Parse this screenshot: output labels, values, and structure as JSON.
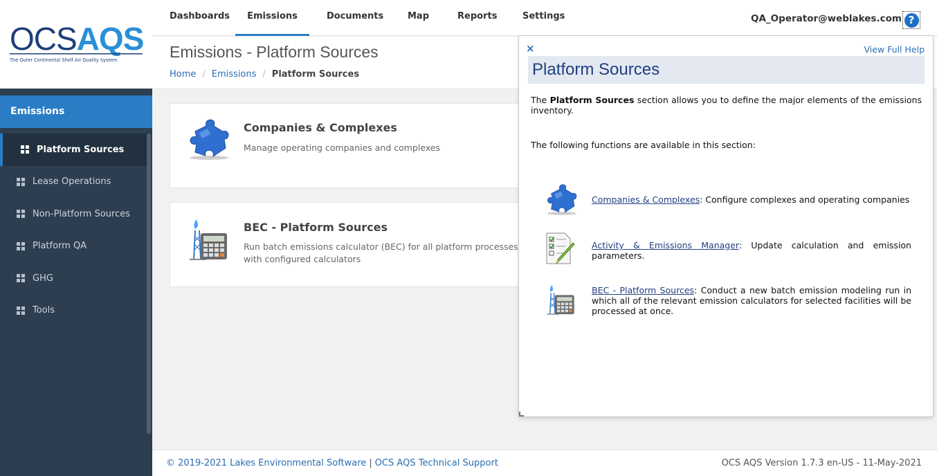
{
  "logo": {
    "primary": "OCS",
    "accent": "AQS",
    "tagline": "The Outer Continental Shelf Air Quality System"
  },
  "sidebar": {
    "section": "Emissions",
    "items": [
      {
        "label": "Platform Sources",
        "active": true
      },
      {
        "label": "Lease Operations",
        "active": false
      },
      {
        "label": "Non-Platform Sources",
        "active": false
      },
      {
        "label": "Platform QA",
        "active": false
      },
      {
        "label": "GHG",
        "active": false
      },
      {
        "label": "Tools",
        "active": false
      }
    ]
  },
  "topnav": {
    "tabs": [
      "Dashboards",
      "Emissions",
      "Documents",
      "Map",
      "Reports",
      "Settings"
    ],
    "active_tab": "Emissions",
    "user": "QA_Operator@weblakes.com",
    "help_icon": "?"
  },
  "page": {
    "title": "Emissions - Platform Sources",
    "breadcrumb": [
      "Home",
      "Emissions",
      "Platform Sources"
    ]
  },
  "cards": [
    {
      "title": "Companies & Complexes",
      "desc": "Manage operating companies and complexes",
      "icon": "puzzle-icon"
    },
    {
      "title": "BEC - Platform Sources",
      "desc": "Run batch emissions calculator (BEC) for all platform processes with configured calculators",
      "icon": "calculator-icon"
    }
  ],
  "help": {
    "close": "×",
    "full_link": "View Full Help",
    "title": "Platform Sources",
    "intro_pre": "The ",
    "intro_bold": "Platform Sources",
    "intro_post": " section allows you to define the major elements of the emissions inventory.",
    "functions_label": "The following functions are available in this section:",
    "items": [
      {
        "link": "Companies & Complexes",
        "text": ": Configure complexes and operating companies"
      },
      {
        "link": "Activity & Emissions Manager",
        "text": ": Update calculation and emission parameters."
      },
      {
        "link": "BEC - Platform Sources",
        "text": ": Conduct a new batch emission modeling run in which all of the relevant emission calculators for selected facilities will be processed at once."
      }
    ]
  },
  "footer": {
    "copyright": "© 2019-2021 Lakes Environmental Software",
    "separator": "|",
    "support": "OCS AQS Technical Support",
    "version": "OCS AQS Version 1.7.3 en-US - 11-May-2021"
  },
  "colors": {
    "accent": "#2a7dc4",
    "sidebar": "#2c3e50",
    "link": "#2a6db3"
  }
}
